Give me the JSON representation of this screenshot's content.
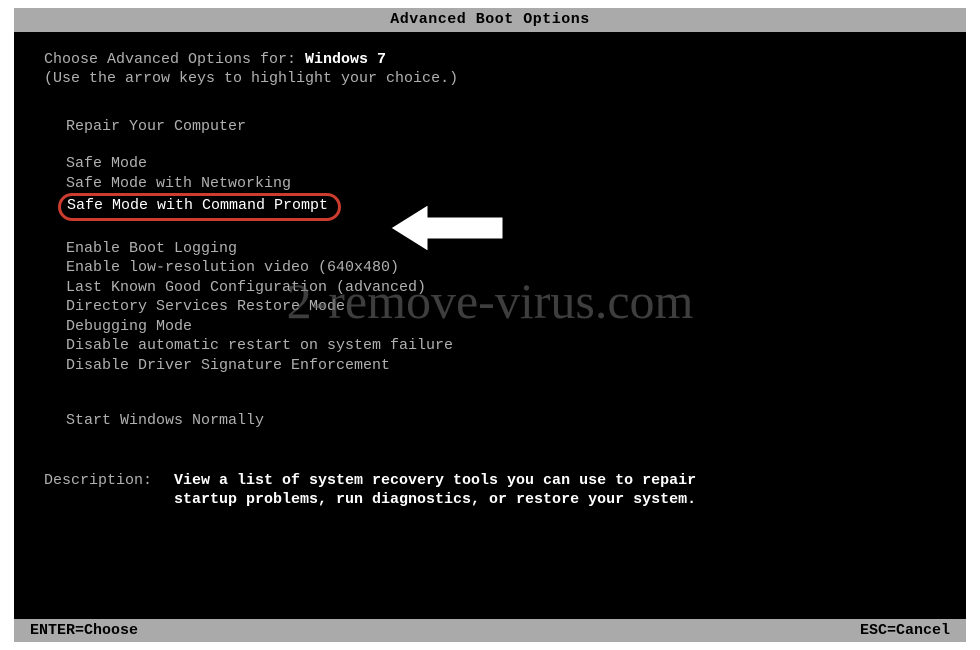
{
  "title": "Advanced Boot Options",
  "header": {
    "prompt_prefix": "Choose Advanced Options for: ",
    "os_name": "Windows 7",
    "hint": "(Use the arrow keys to highlight your choice.)"
  },
  "menu": {
    "repair": "Repair Your Computer",
    "items": [
      "Safe Mode",
      "Safe Mode with Networking",
      "Safe Mode with Command Prompt",
      "Enable Boot Logging",
      "Enable low-resolution video (640x480)",
      "Last Known Good Configuration (advanced)",
      "Directory Services Restore Mode",
      "Debugging Mode",
      "Disable automatic restart on system failure",
      "Disable Driver Signature Enforcement"
    ],
    "start_normal": "Start Windows Normally"
  },
  "description": {
    "label": "Description:",
    "text_line1": "View a list of system recovery tools you can use to repair",
    "text_line2": "startup problems, run diagnostics, or restore your system."
  },
  "footer": {
    "left": "ENTER=Choose",
    "right": "ESC=Cancel"
  },
  "watermark": "2-remove-virus.com",
  "highlighted_index": 2
}
